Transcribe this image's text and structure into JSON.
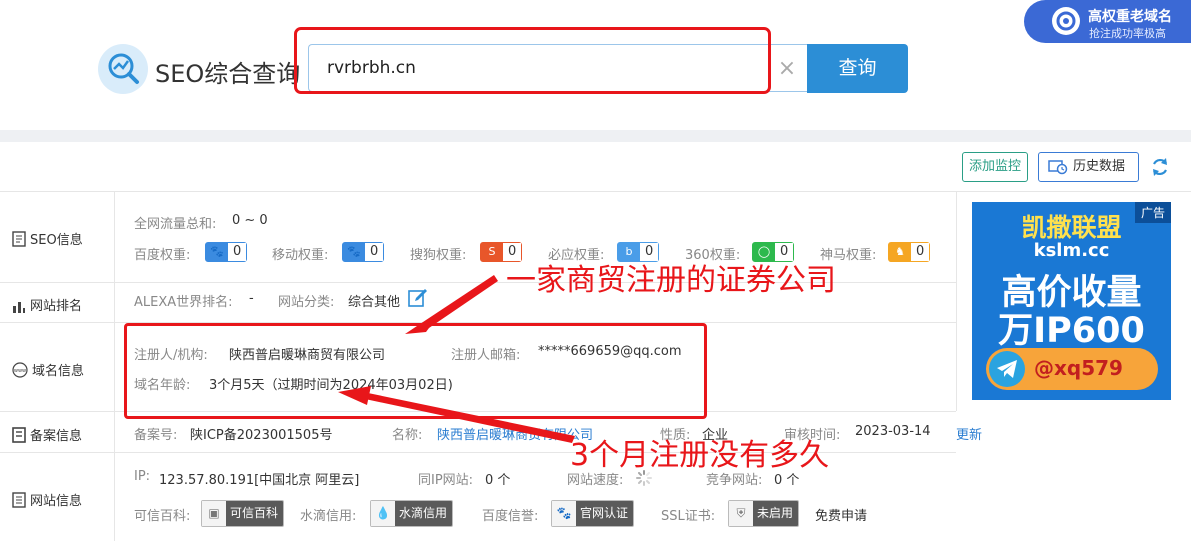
{
  "header": {
    "logo_text": "SEO综合查询",
    "search_value": "rvrbrbh.cn",
    "search_button_label": "查询",
    "badge_title": "高权重老域名",
    "badge_subtitle": "抢注成功率极高"
  },
  "toolbar": {
    "monitor_label": "添加监控",
    "history_label": "历史数据"
  },
  "sections": {
    "seo": "SEO信息",
    "rank": "网站排名",
    "domain": "域名信息",
    "icp": "备案信息",
    "site": "网站信息"
  },
  "seo": {
    "traffic_label": "全网流量总和:",
    "traffic_value": "0 ~ 0",
    "weights": [
      {
        "label": "百度权重:",
        "value": "0",
        "color": "#3b8be0"
      },
      {
        "label": "移动权重:",
        "value": "0",
        "color": "#3b8be0"
      },
      {
        "label": "搜狗权重:",
        "value": "0",
        "color": "#e8562a"
      },
      {
        "label": "必应权重:",
        "value": "0",
        "color": "#4a9de8"
      },
      {
        "label": "360权重:",
        "value": "0",
        "color": "#2db94d"
      },
      {
        "label": "神马权重:",
        "value": "0",
        "color": "#f5a623"
      }
    ]
  },
  "rank": {
    "alexa_label": "ALEXA世界排名:",
    "alexa_value": "-",
    "category_label": "网站分类:",
    "category_value": "综合其他"
  },
  "whois": {
    "registrant_label": "注册人/机构:",
    "registrant_value": "陕西普启暖琳商贸有限公司",
    "email_label": "注册人邮箱:",
    "email_value": "*****669659@qq.com",
    "age_label": "域名年龄:",
    "age_value": "3个月5天（过期时间为2024年03月02日)"
  },
  "icp": {
    "number_label": "备案号:",
    "number_value": "陕ICP备2023001505号",
    "name_label": "名称:",
    "name_value": "陕西普启暖琳商贸有限公司",
    "nature_label": "性质:",
    "nature_value": "企业",
    "date_label": "审核时间:",
    "date_value": "2023-03-14",
    "update_link": "更新"
  },
  "site": {
    "ip_label": "IP:",
    "ip_value": "123.57.80.191[中国北京 阿里云]",
    "sameip_label": "同IP网站:",
    "sameip_value": "0 个",
    "speed_label": "网站速度:",
    "compete_label": "竞争网站:",
    "compete_value": "0 个",
    "credits": [
      {
        "label": "可信百科:",
        "badge": "可信百科"
      },
      {
        "label": "水滴信用:",
        "badge": "水滴信用"
      },
      {
        "label": "百度信誉:",
        "badge": "官网认证"
      },
      {
        "label": "SSL证书:",
        "badge": "未启用"
      }
    ],
    "ssl_apply": "免费申请"
  },
  "ad": {
    "tag": "广告",
    "title": "凯撒联盟",
    "domain": "kslm.cc",
    "line1": "高价收量",
    "line2": "万IP600",
    "handle": "@xq579"
  },
  "annotations": {
    "company_note": "一家商贸注册的证券公司",
    "age_note": "3个月注册没有多久"
  }
}
